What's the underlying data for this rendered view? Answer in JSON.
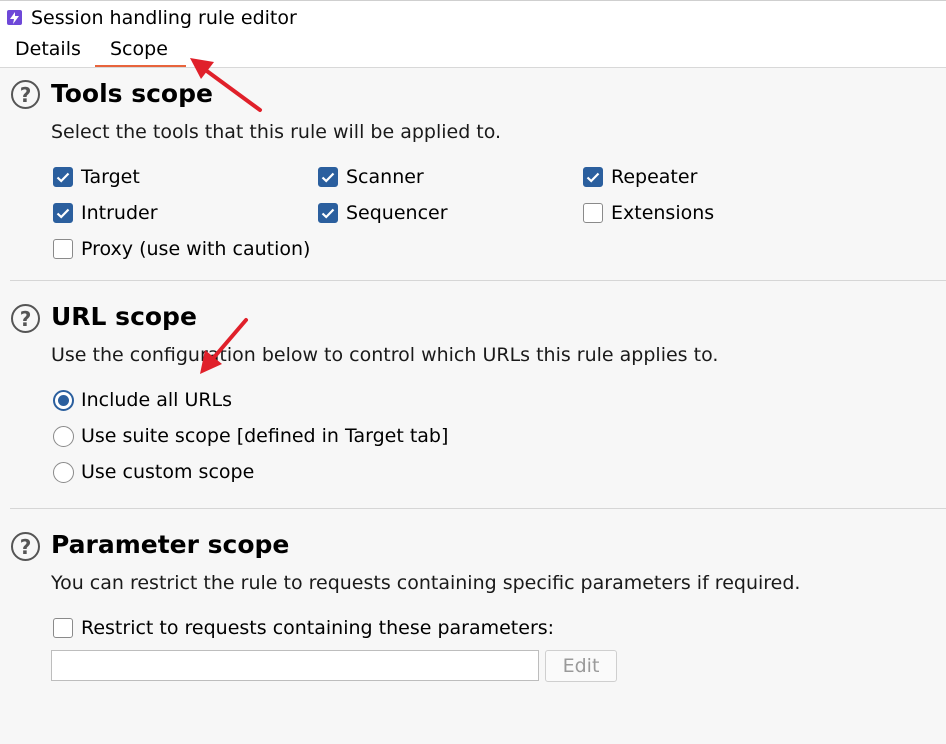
{
  "window": {
    "title": "Session handling rule editor",
    "app_icon": "lightning-icon"
  },
  "tabs": [
    {
      "label": "Details",
      "active": false
    },
    {
      "label": "Scope",
      "active": true
    }
  ],
  "accent_colors": {
    "tab_underline": "#e8643c",
    "checkbox": "#2b5f9e",
    "annotation_arrow": "#e0202a"
  },
  "tools_scope": {
    "title": "Tools scope",
    "description": "Select the tools that this rule will be applied to.",
    "options": [
      {
        "label": "Target",
        "checked": true
      },
      {
        "label": "Scanner",
        "checked": true
      },
      {
        "label": "Repeater",
        "checked": true
      },
      {
        "label": "Intruder",
        "checked": true
      },
      {
        "label": "Sequencer",
        "checked": true
      },
      {
        "label": "Extensions",
        "checked": false
      },
      {
        "label": "Proxy (use with caution)",
        "checked": false
      }
    ]
  },
  "url_scope": {
    "title": "URL scope",
    "description": "Use the configuration below to control which URLs this rule applies to.",
    "options": [
      {
        "label": "Include all URLs",
        "selected": true
      },
      {
        "label": "Use suite scope [defined in Target tab]",
        "selected": false
      },
      {
        "label": "Use custom scope",
        "selected": false
      }
    ]
  },
  "parameter_scope": {
    "title": "Parameter scope",
    "description": "You can restrict the rule to requests containing specific parameters if required.",
    "restrict_label": "Restrict to requests containing these parameters:",
    "restrict_checked": false,
    "input_value": "",
    "edit_label": "Edit"
  }
}
